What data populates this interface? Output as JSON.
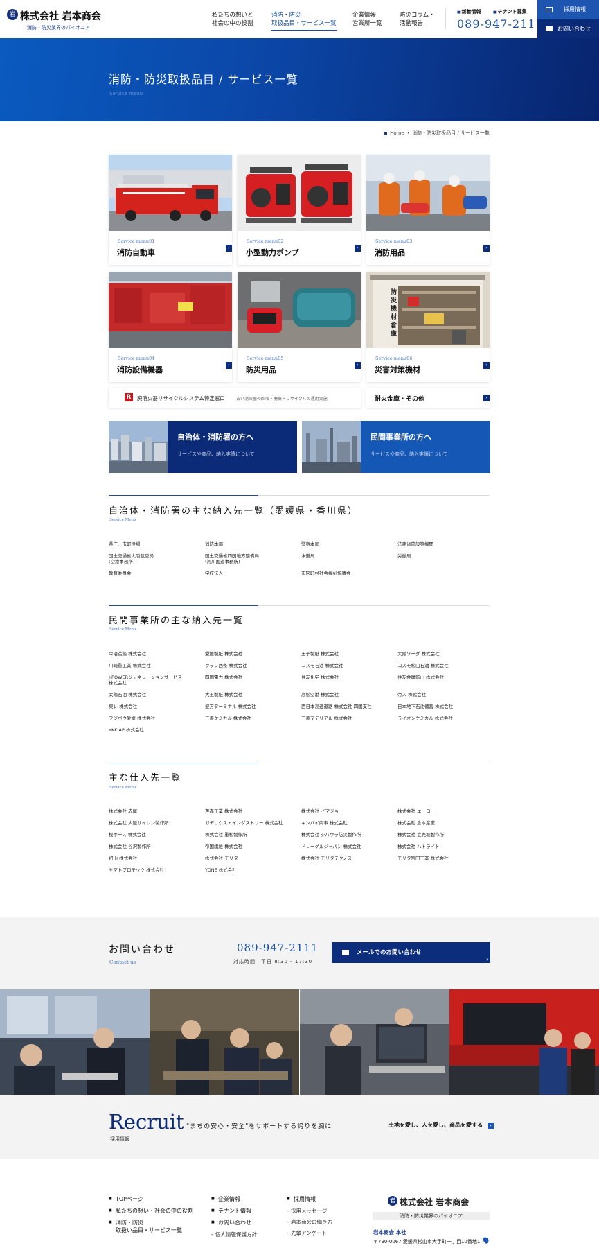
{
  "header": {
    "logo_mark": "岩",
    "company": "株式会社 岩本商会",
    "tagline": "消防・防災業界のパイオニア",
    "nav": [
      {
        "label": "私たちの想いと\n社会の中の役割"
      },
      {
        "label": "消防・防災\n取扱品目・サービス一覧"
      },
      {
        "label": "企業情報\n営業所一覧"
      },
      {
        "label": "防災コラム・\n活動報告"
      }
    ],
    "link_news": "新着情報",
    "link_tenant": "テナント募集",
    "phone": "089-947-2111",
    "recruit_btn": "採用情報",
    "contact_btn": "お問い合わせ"
  },
  "hero": {
    "title": "消防・防災取扱品目 / サービス一覧",
    "subtitle": "Service menu"
  },
  "breadcrumb": "Home ・ 消防・防災取扱品目 / サービス一覧",
  "menu": [
    {
      "num": "Service menu01",
      "title": "消防自動車"
    },
    {
      "num": "Service menu02",
      "title": "小型動力ポンプ"
    },
    {
      "num": "Service menu03",
      "title": "消防用品"
    },
    {
      "num": "Service menu04",
      "title": "消防設備機器"
    },
    {
      "num": "Service menu05",
      "title": "防災用品"
    },
    {
      "num": "Service menu06",
      "title": "災害対策機材"
    }
  ],
  "recycle": {
    "logo": "R",
    "title": "廃消火器リサイクルシステム特定窓口",
    "desc": "古い消火器の回収・廃棄・リサイクルの運用実施"
  },
  "safe_bar": "耐火金庫・その他",
  "storehouse_sign": "防災機材倉庫",
  "cta": [
    {
      "title": "自治体・消防署の方へ",
      "desc": "サービスや商品、納入実績について"
    },
    {
      "title": "民間事業所の方へ",
      "desc": "サービスや商品、納入実績について"
    }
  ],
  "sections": [
    {
      "title": "自治体・消防署の主な納入先一覧（愛媛県・香川県）",
      "sub": "Service Menu",
      "items": [
        "県庁、市町役場",
        "消防本部",
        "警察本部",
        "法務省施設等機関",
        "国土交通省大阪航空局\n(空港事務所)",
        "国土交通省四国地方整備局\n(河川国道事務所)",
        "水道局",
        "労働局",
        "教育委員会",
        "学校法人",
        "市区町村社会福祉協議会",
        ""
      ]
    },
    {
      "title": "民間事業所の主な納入先一覧",
      "sub": "Service Menu",
      "items": [
        "今治造船 株式会社",
        "愛媛製紙 株式会社",
        "王子製紙 株式会社",
        "大阪ソーダ 株式会社",
        "川崎重工業 株式会社",
        "クラレ西条 株式会社",
        "コスモ石油 株式会社",
        "コスモ松山石油 株式会社",
        "J-POWERジェネレーションサービス\n株式会社",
        "四国電力 株式会社",
        "住友化学 株式会社",
        "住友金属鉱山 株式会社",
        "太陽石油 株式会社",
        "大王製紙 株式会社",
        "高松空港 株式会社",
        "帝人 株式会社",
        "東レ 株式会社",
        "波方ターミナル 株式会社",
        "西日本高速道路 株式会社 四国支社",
        "日本地下石油備蓄 株式会社",
        "フジボウ愛媛 株式会社",
        "三菱ケミカル 株式会社",
        "三菱マテリアル 株式会社",
        "ライオンケミカル 株式会社",
        "YKK AP 株式会社",
        "",
        "",
        ""
      ]
    },
    {
      "title": "主な仕入先一覧",
      "sub": "Service Menu",
      "items": [
        "株式会社 赤尾",
        "芦森工業 株式会社",
        "株式会社 イマジョー",
        "株式会社 エーコー",
        "株式会社 大阪サイレン製作所",
        "ガデリウス・インダストリー 株式会社",
        "キンパイ商事 株式会社",
        "株式会社 倉本産業",
        "桜ホース 株式会社",
        "株式会社 重松製作所",
        "株式会社 シバウラ防災製作所",
        "株式会社 立売堀製作所",
        "株式会社 谷沢製作所",
        "帝国繊維 株式会社",
        "ドレーゲルジャパン 株式会社",
        "株式会社 ハトライト",
        "初山 株式会社",
        "株式会社 モリタ",
        "株式会社 モリタテクノス",
        "モリタ宮田工業 株式会社",
        "ヤマトプロテック 株式会社",
        "YONE 株式会社",
        "",
        ""
      ]
    }
  ],
  "contact": {
    "title": "お問い合わせ",
    "sub": "Contact us",
    "phone": "089-947-2111",
    "hours": "対応時間　平日 8:30 - 17:30",
    "mail_btn": "メールでのお問い合わせ"
  },
  "recruit": {
    "title": "Recruit",
    "jp": "採用情報",
    "copy": "\"まちの安心・安全\"をサポートする誇りを胸に",
    "link": "土地を愛し、人を愛し、商品を愛する"
  },
  "footer": {
    "col1": [
      "TOPページ",
      "私たちの想い・社会の中の役割",
      "消防・防災\n取扱い品目・サービス一覧"
    ],
    "col2": [
      "企業情報",
      "テナント情報",
      "お問い合わせ"
    ],
    "col2_sub": [
      "個人情報保護方針"
    ],
    "col3": [
      "採用情報"
    ],
    "col3_sub": [
      "採用メッセージ",
      "岩本商会の働き方",
      "先輩アンケート"
    ],
    "logo_mark": "岩",
    "company": "株式会社 岩本商会",
    "tagline": "消防・防災業界のパイオニア",
    "hq": "岩本商会 本社",
    "address": "〒790-0067 愛媛県松山市大手町一丁目10番地1"
  },
  "colors": {
    "navy": "#0b2a78",
    "blue": "#1e55b0",
    "accent": "#1a4fa0",
    "truck_red": "#d4221c"
  }
}
